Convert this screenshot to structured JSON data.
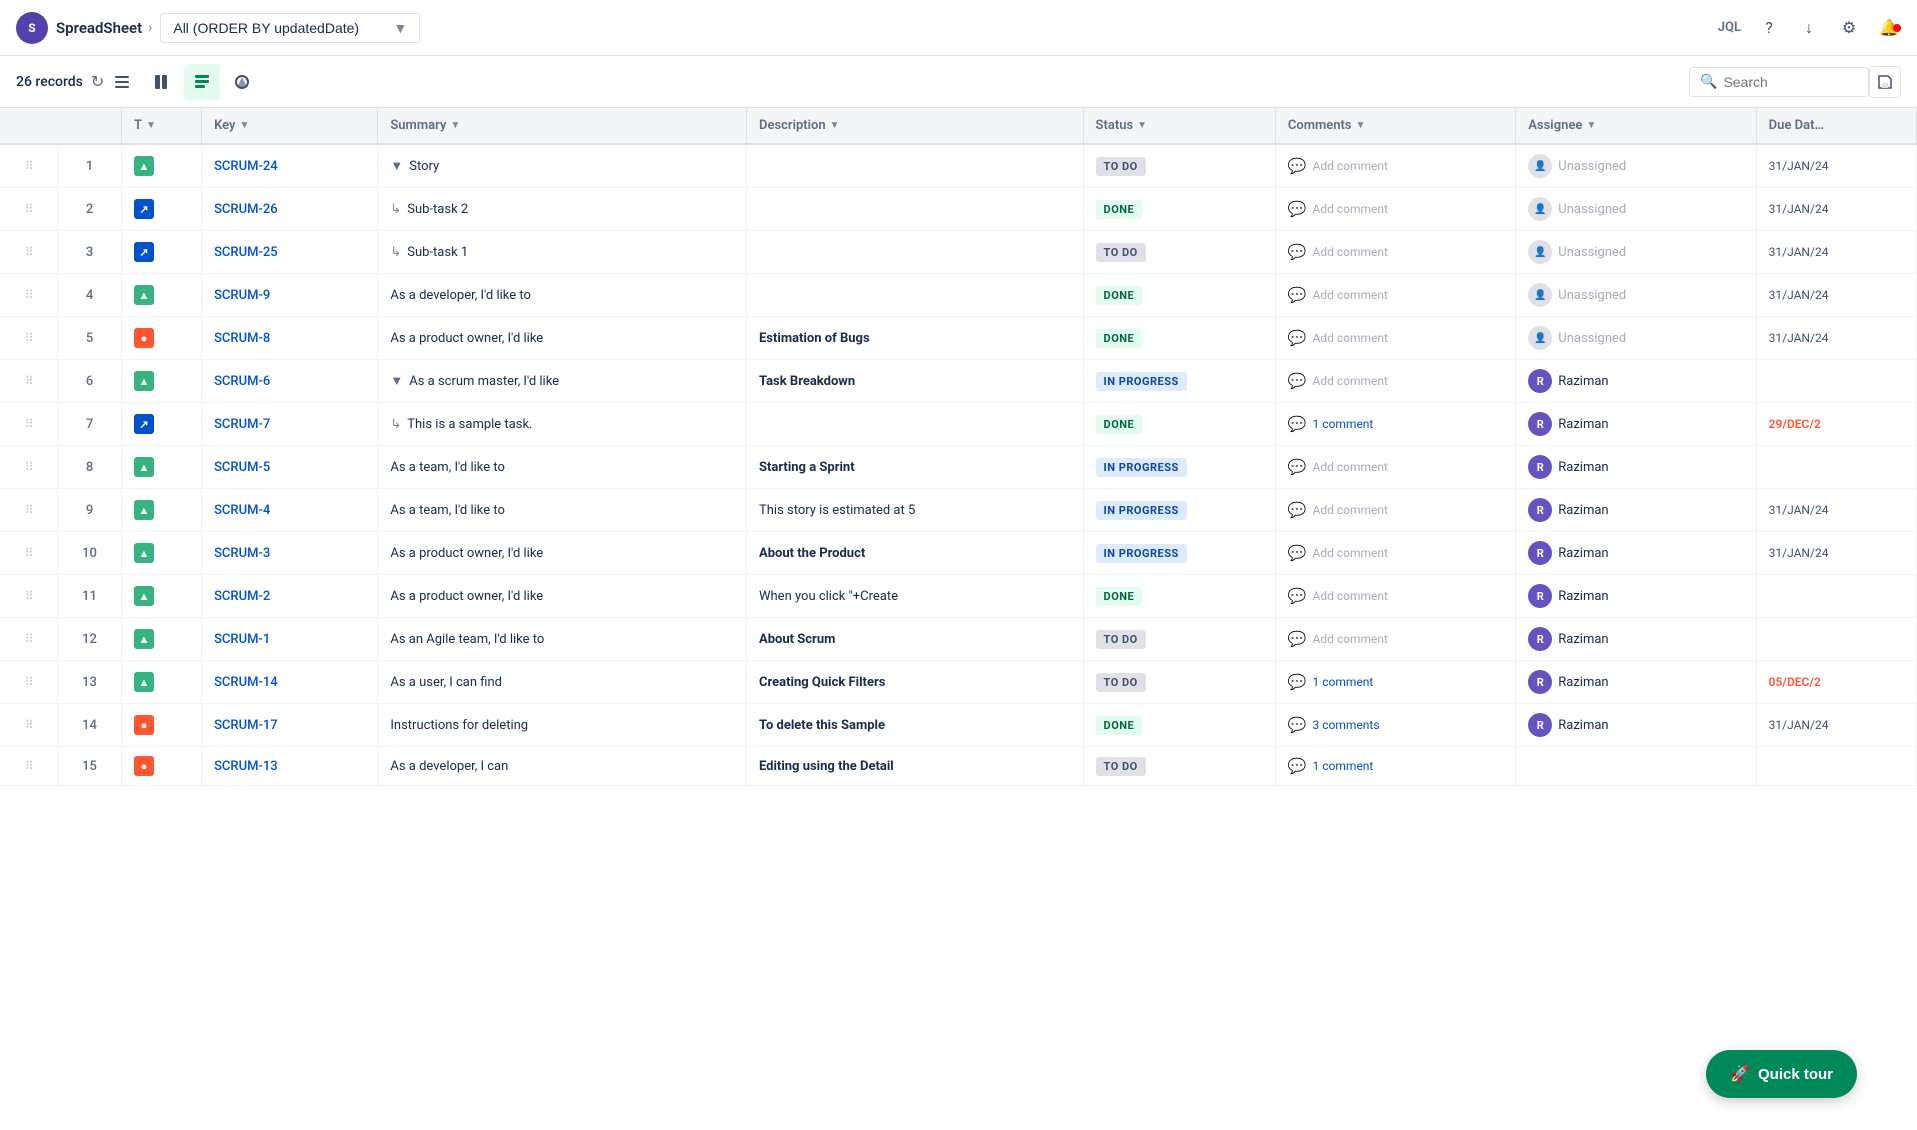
{
  "header": {
    "logo_text": "S",
    "app_name": "SpreadSheet",
    "breadcrumb_separator": ">",
    "dropdown_label": "All (ORDER BY updatedDate)",
    "jql_label": "JQL",
    "record_count": "26 records"
  },
  "toolbar": {
    "search_placeholder": "Search",
    "view_icons": [
      {
        "name": "list-view",
        "active": false,
        "icon": "☰"
      },
      {
        "name": "board-view",
        "active": false,
        "icon": "⊞"
      },
      {
        "name": "backlog-view",
        "active": true,
        "icon": "≡"
      },
      {
        "name": "roadmap-view",
        "active": false,
        "icon": "⚑"
      }
    ]
  },
  "table": {
    "columns": [
      "",
      "T",
      "Key",
      "Summary",
      "Description",
      "Status",
      "Comments",
      "Assignee",
      "Due Date"
    ],
    "rows": [
      {
        "num": 1,
        "type": "story",
        "key": "SCRUM-24",
        "summary": "Story",
        "summary_type": "collapsed",
        "description": "",
        "status": "TO DO",
        "status_class": "todo",
        "comments": "Add comment",
        "comments_type": "add",
        "assignee": "Unassigned",
        "assignee_type": "unassigned",
        "due_date": "31/JAN/24",
        "due_class": "normal"
      },
      {
        "num": 2,
        "type": "subtask",
        "key": "SCRUM-26",
        "summary": "Sub-task 2",
        "summary_type": "subtask",
        "description": "",
        "status": "DONE",
        "status_class": "done",
        "comments": "Add comment",
        "comments_type": "add",
        "assignee": "Unassigned",
        "assignee_type": "unassigned",
        "due_date": "31/JAN/24",
        "due_class": "normal"
      },
      {
        "num": 3,
        "type": "subtask",
        "key": "SCRUM-25",
        "summary": "Sub-task 1",
        "summary_type": "subtask",
        "description": "",
        "status": "TO DO",
        "status_class": "todo",
        "comments": "Add comment",
        "comments_type": "add",
        "assignee": "Unassigned",
        "assignee_type": "unassigned",
        "due_date": "31/JAN/24",
        "due_class": "normal"
      },
      {
        "num": 4,
        "type": "story",
        "key": "SCRUM-9",
        "summary": "As a developer, I'd like to",
        "summary_type": "normal",
        "description": "",
        "status": "DONE",
        "status_class": "done",
        "comments": "Add comment",
        "comments_type": "add",
        "assignee": "Unassigned",
        "assignee_type": "unassigned",
        "due_date": "31/JAN/24",
        "due_class": "normal"
      },
      {
        "num": 5,
        "type": "bug",
        "key": "SCRUM-8",
        "summary": "As a product owner, I'd like",
        "summary_type": "normal",
        "description": "Estimation of Bugs",
        "description_bold": true,
        "status": "DONE",
        "status_class": "done",
        "comments": "Add comment",
        "comments_type": "add",
        "assignee": "Unassigned",
        "assignee_type": "unassigned",
        "due_date": "31/JAN/24",
        "due_class": "normal"
      },
      {
        "num": 6,
        "type": "story",
        "key": "SCRUM-6",
        "summary": "As a scrum master, I'd like",
        "summary_type": "collapsed",
        "description": "Task Breakdown",
        "description_bold": true,
        "status": "IN PROGRESS",
        "status_class": "inprogress",
        "comments": "Add comment",
        "comments_type": "add",
        "assignee": "Raziman",
        "assignee_type": "user",
        "due_date": "",
        "due_class": "normal"
      },
      {
        "num": 7,
        "type": "subtask",
        "key": "SCRUM-7",
        "summary": "This is a sample task.",
        "summary_type": "subtask",
        "description": "",
        "status": "DONE",
        "status_class": "done",
        "comments": "1 comment",
        "comments_type": "link",
        "assignee": "Raziman",
        "assignee_type": "user",
        "due_date": "29/DEC/2",
        "due_class": "overdue"
      },
      {
        "num": 8,
        "type": "story",
        "key": "SCRUM-5",
        "summary": "As a team, I'd like to",
        "summary_type": "normal",
        "description": "Starting a Sprint",
        "description_bold": true,
        "status": "IN PROGRESS",
        "status_class": "inprogress",
        "comments": "Add comment",
        "comments_type": "add",
        "assignee": "Raziman",
        "assignee_type": "user",
        "due_date": "",
        "due_class": "normal"
      },
      {
        "num": 9,
        "type": "story",
        "key": "SCRUM-4",
        "summary": "As a team, I'd like to",
        "summary_type": "normal",
        "description": "This story is estimated at 5",
        "description_bold": false,
        "status": "IN PROGRESS",
        "status_class": "inprogress",
        "comments": "Add comment",
        "comments_type": "add",
        "assignee": "Raziman",
        "assignee_type": "user",
        "due_date": "31/JAN/24",
        "due_class": "normal"
      },
      {
        "num": 10,
        "type": "story",
        "key": "SCRUM-3",
        "summary": "As a product owner, I'd like",
        "summary_type": "normal",
        "description": "About the Product",
        "description_bold": true,
        "status": "IN PROGRESS",
        "status_class": "inprogress",
        "comments": "Add comment",
        "comments_type": "add",
        "assignee": "Raziman",
        "assignee_type": "user",
        "due_date": "31/JAN/24",
        "due_class": "normal"
      },
      {
        "num": 11,
        "type": "story",
        "key": "SCRUM-2",
        "summary": "As a product owner, I'd like",
        "summary_type": "normal",
        "description": "When you click \"+Create",
        "description_bold": false,
        "status": "DONE",
        "status_class": "done",
        "comments": "Add comment",
        "comments_type": "add",
        "assignee": "Raziman",
        "assignee_type": "user",
        "due_date": "",
        "due_class": "normal"
      },
      {
        "num": 12,
        "type": "story",
        "key": "SCRUM-1",
        "summary": "As an Agile team, I'd like to",
        "summary_type": "normal",
        "description": "About Scrum",
        "description_bold": true,
        "status": "TO DO",
        "status_class": "todo",
        "comments": "Add comment",
        "comments_type": "add",
        "assignee": "Raziman",
        "assignee_type": "user",
        "due_date": "",
        "due_class": "normal"
      },
      {
        "num": 13,
        "type": "story",
        "key": "SCRUM-14",
        "summary": "As a user, I can find",
        "summary_type": "normal",
        "description": "Creating Quick Filters",
        "description_bold": true,
        "status": "TO DO",
        "status_class": "todo",
        "comments": "1 comment",
        "comments_type": "link",
        "assignee": "Raziman",
        "assignee_type": "user",
        "due_date": "05/DEC/2",
        "due_class": "overdue"
      },
      {
        "num": 14,
        "type": "bug",
        "key": "SCRUM-17",
        "summary": "Instructions for deleting",
        "summary_type": "normal",
        "description": "To delete this Sample",
        "description_bold": true,
        "status": "DONE",
        "status_class": "done",
        "comments": "3 comments",
        "comments_type": "link",
        "assignee": "Raziman",
        "assignee_type": "user",
        "due_date": "31/JAN/24",
        "due_class": "normal"
      },
      {
        "num": 15,
        "type": "bug",
        "key": "SCRUM-13",
        "summary": "As a developer, I can",
        "summary_type": "normal",
        "description": "Editing using the Detail",
        "description_bold": true,
        "status": "TO DO",
        "status_class": "todo",
        "comments": "1 comment",
        "comments_type": "link",
        "assignee": "",
        "assignee_type": "user",
        "due_date": "",
        "due_class": "normal"
      }
    ]
  },
  "quick_tour": {
    "label": "Quick tour"
  }
}
